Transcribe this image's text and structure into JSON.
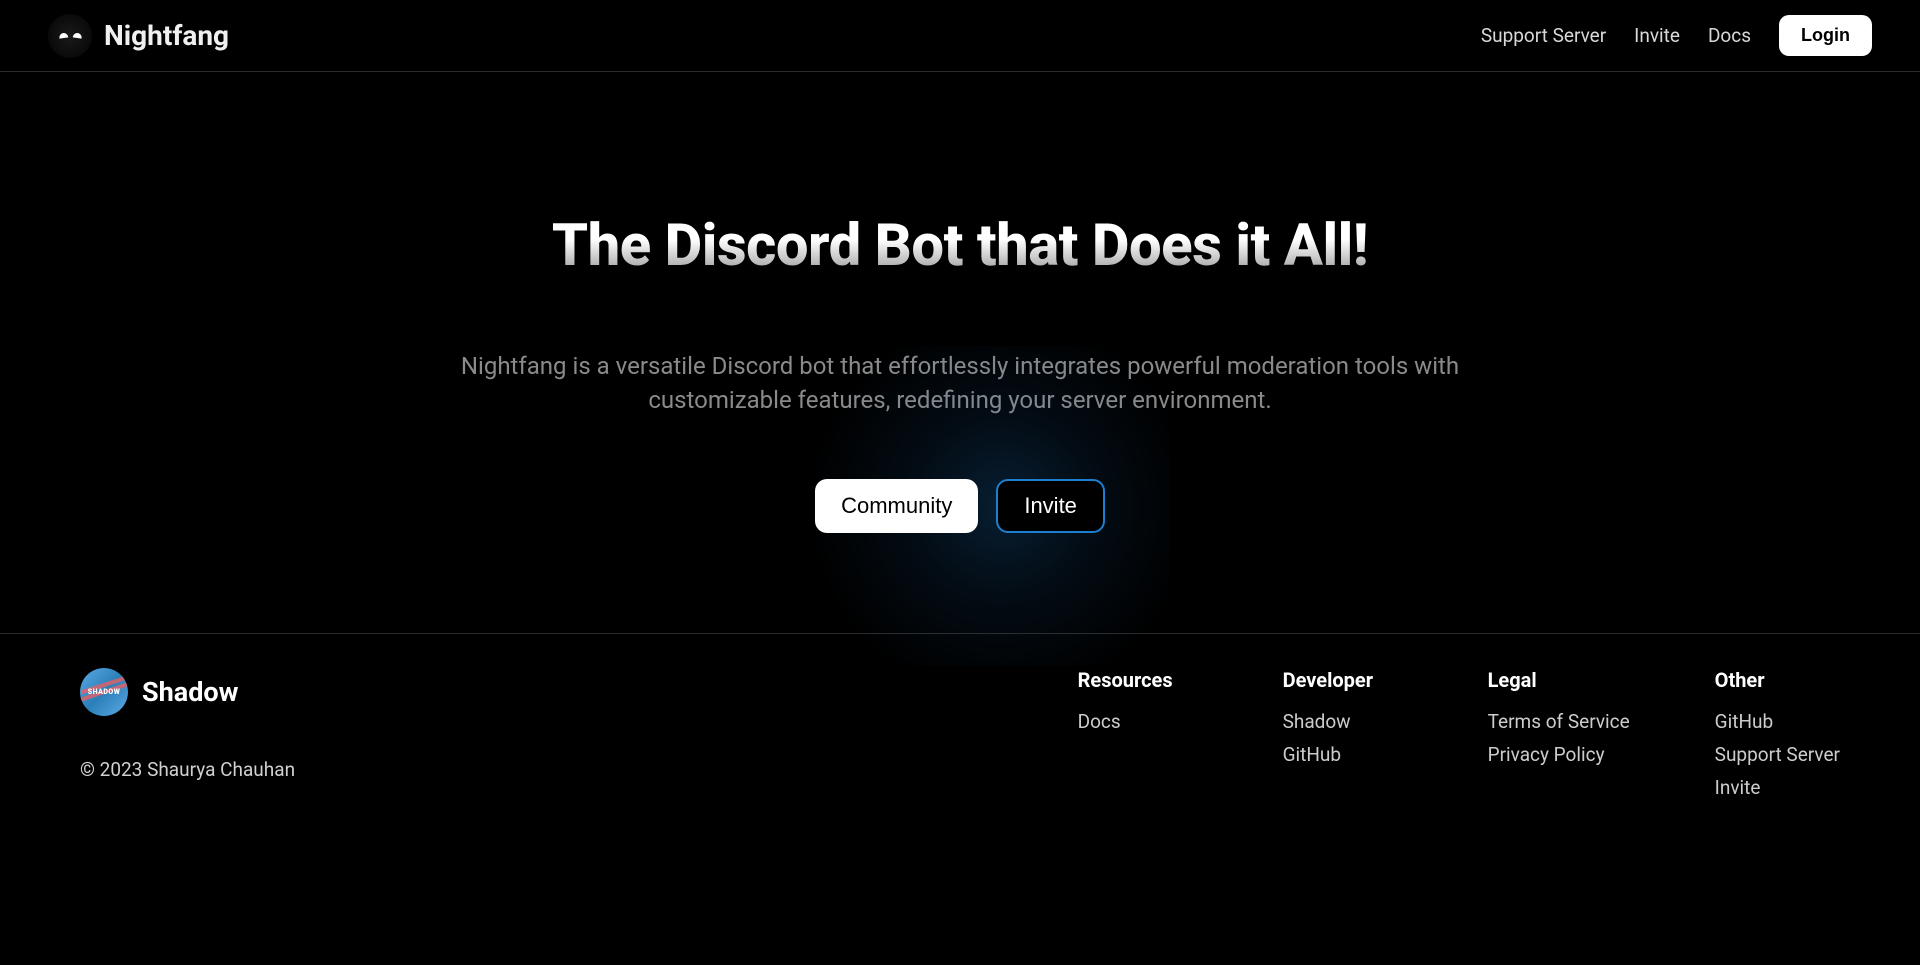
{
  "header": {
    "brand": "Nightfang",
    "nav": [
      "Support Server",
      "Invite",
      "Docs"
    ],
    "login": "Login"
  },
  "hero": {
    "title": "The Discord Bot that Does it All!",
    "description": "Nightfang is a versatile Discord bot that effortlessly integrates powerful moderation tools with customizable features, redefining your server environment.",
    "primary_btn": "Community",
    "secondary_btn": "Invite"
  },
  "footer": {
    "brand": "Shadow",
    "copyright": "© 2023 Shaurya Chauhan",
    "columns": [
      {
        "title": "Resources",
        "links": [
          "Docs"
        ]
      },
      {
        "title": "Developer",
        "links": [
          "Shadow",
          "GitHub"
        ]
      },
      {
        "title": "Legal",
        "links": [
          "Terms of Service",
          "Privacy Policy"
        ]
      },
      {
        "title": "Other",
        "links": [
          "GitHub",
          "Support Server",
          "Invite"
        ]
      }
    ]
  }
}
